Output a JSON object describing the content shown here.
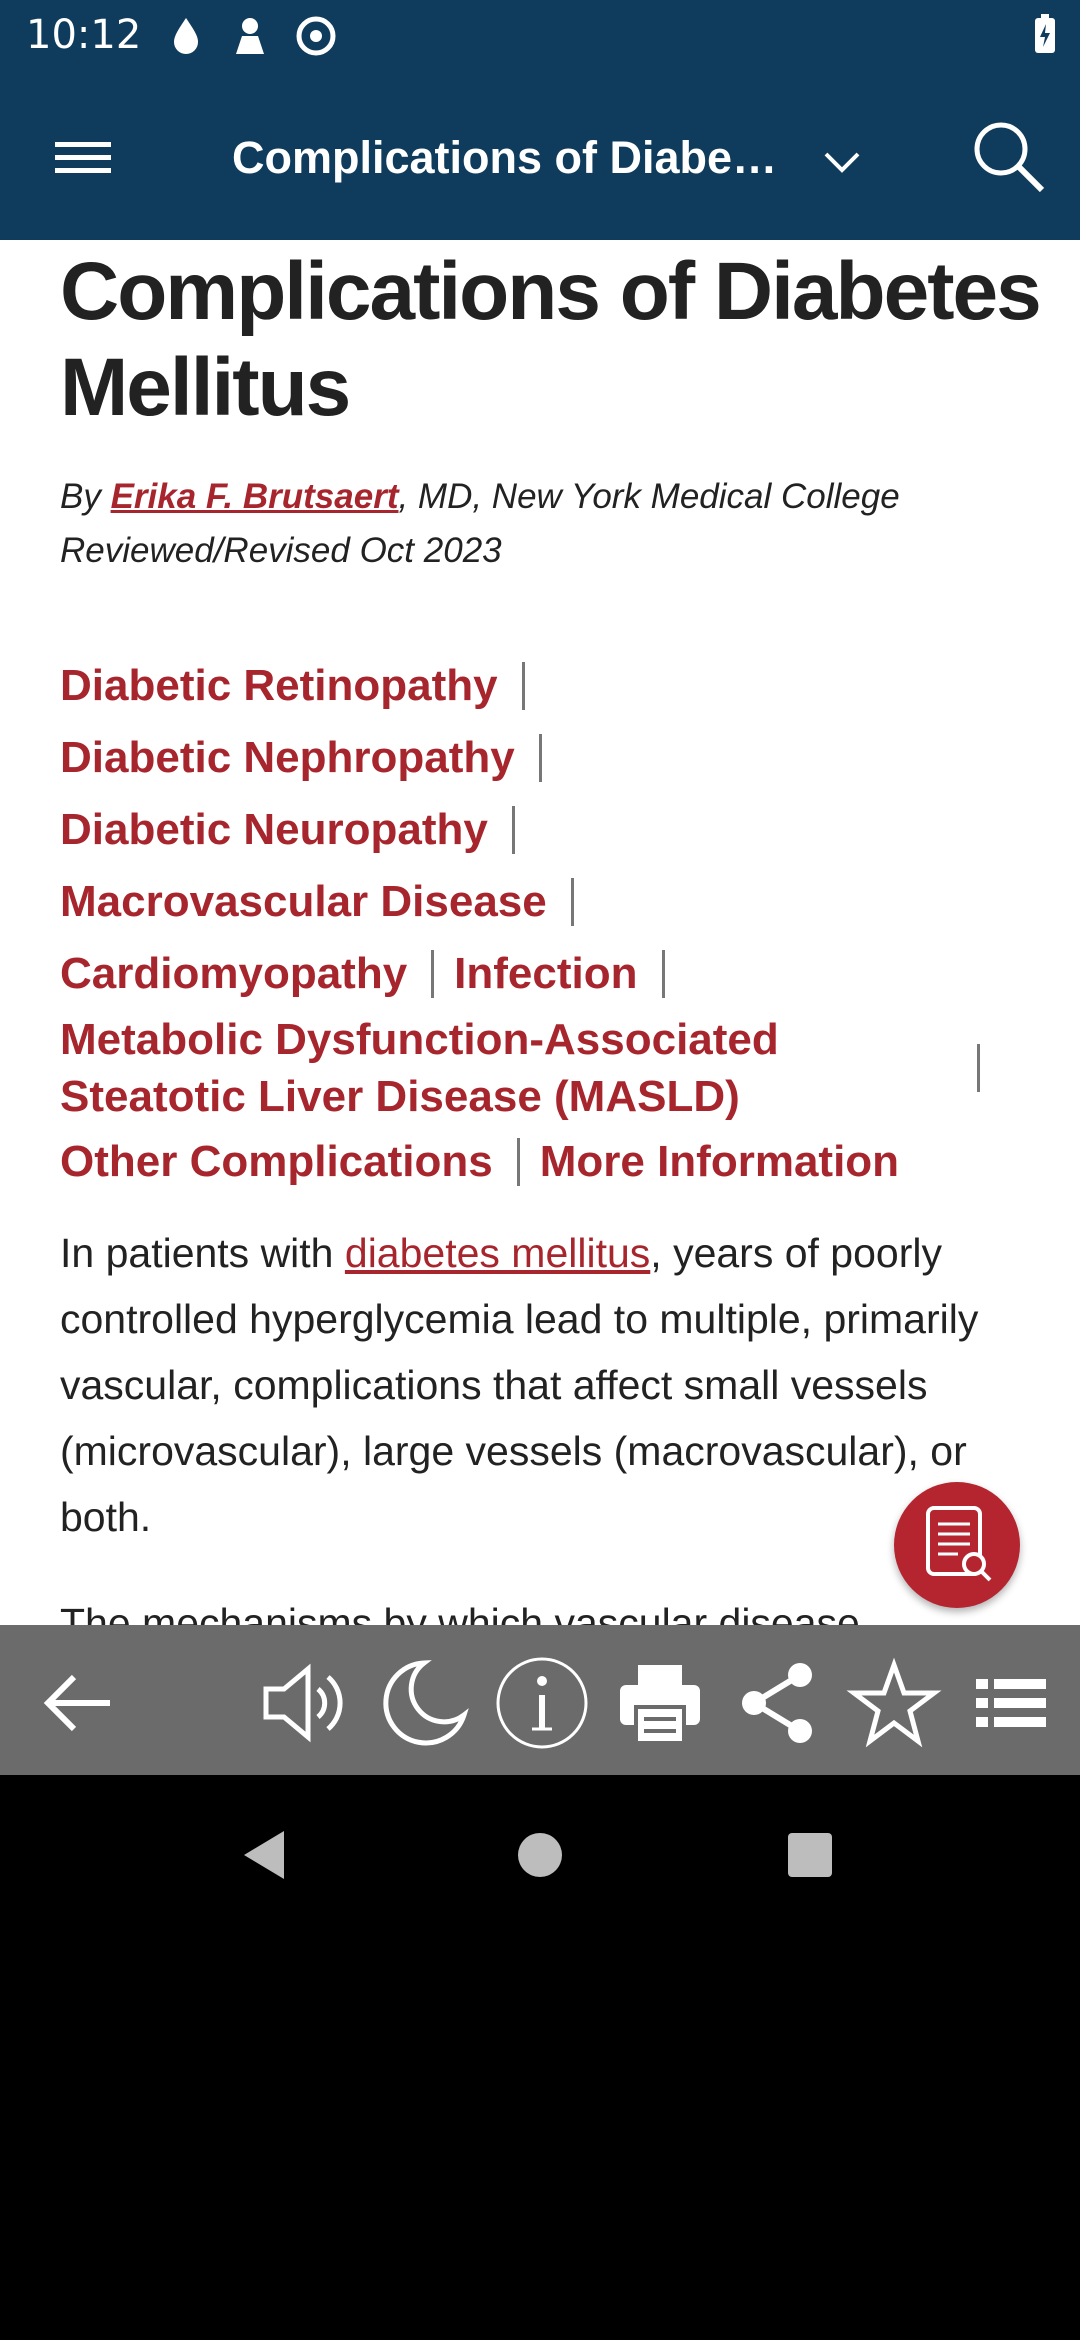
{
  "status_bar": {
    "time": "10:12"
  },
  "app_bar": {
    "title": "Complications of Diabet…"
  },
  "article": {
    "title": "Complications of Diabetes Mellitus",
    "byline_prefix": "By ",
    "author": "Erika F. Brutsaert",
    "author_suffix": ", MD, New York Medical College",
    "reviewed": "Reviewed/Revised Oct 2023",
    "toc": [
      "Diabetic Retinopathy",
      "Diabetic Nephropathy",
      "Diabetic Neuropathy",
      "Macrovascular Disease",
      "Cardiomyopathy",
      "Infection",
      "Metabolic Dysfunction-Associated",
      "Steatotic Liver Disease (MASLD)",
      "Other Complications",
      "More Information"
    ],
    "intro_before": "In patients with ",
    "intro_link": "diabetes mellitus",
    "intro_after": ", years of poorly controlled hyperglycemia lead to multiple, primarily vascular, complications that affect small vessels (microvascular), large vessels (macrovascular), or both.",
    "cut_line": "The mechanisms by which vascular disease"
  },
  "icons": {
    "menu": "menu-icon",
    "dropdown": "chevron-down-icon",
    "search": "search-icon",
    "fab": "document-search-icon",
    "back": "arrow-left-icon",
    "speaker": "speaker-icon",
    "night": "moon-icon",
    "info": "info-icon",
    "print": "printer-icon",
    "share": "share-icon",
    "bookmark": "star-icon",
    "list": "list-icon"
  },
  "colors": {
    "app_bar": "#0f3c5c",
    "accent": "#a7262e",
    "toolbar": "#6b6b6b"
  }
}
